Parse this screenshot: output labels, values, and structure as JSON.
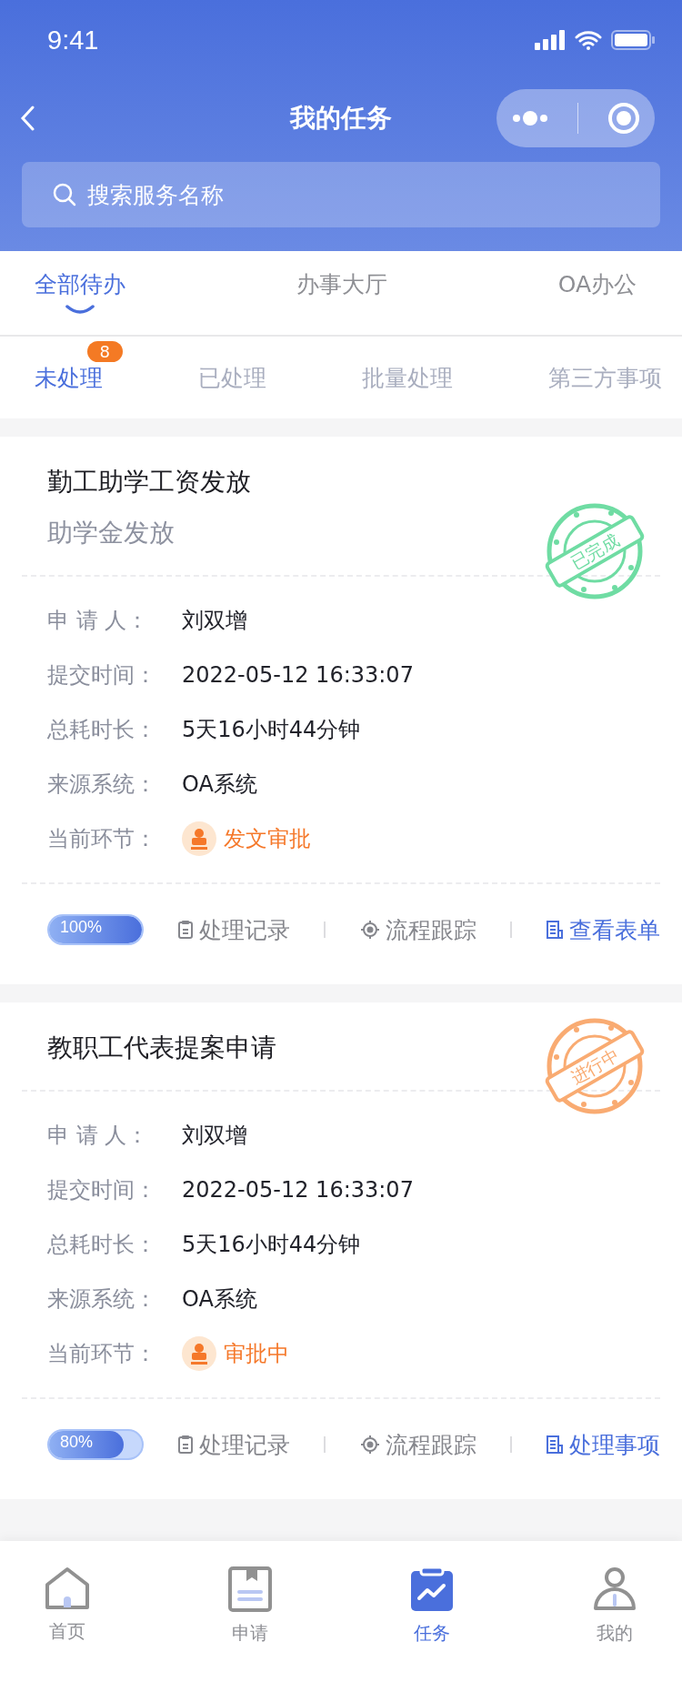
{
  "status_bar": {
    "time": "9:41"
  },
  "nav": {
    "title": "我的任务"
  },
  "search": {
    "placeholder": "搜索服务名称"
  },
  "tabs": [
    {
      "label": "全部待办",
      "selected": true
    },
    {
      "label": "办事大厅",
      "selected": false
    },
    {
      "label": "OA办公",
      "selected": false
    }
  ],
  "subtabs": [
    {
      "label": "未处理",
      "selected": true,
      "badge": "8"
    },
    {
      "label": "已处理",
      "selected": false
    },
    {
      "label": "批量处理",
      "selected": false
    },
    {
      "label": "第三方事项",
      "selected": false
    }
  ],
  "tasks": [
    {
      "title": "勤工助学工资发放",
      "subtitle": "助学金发放",
      "stamp": {
        "label": "已完成",
        "kind": "done"
      },
      "fields": [
        {
          "label": "申 请 人：",
          "value": "刘双增"
        },
        {
          "label": "提交时间：",
          "value": "2022-05-12 16:33:07"
        },
        {
          "label": "总耗时长：",
          "value": "5天16小时44分钟"
        },
        {
          "label": "来源系统：",
          "value": "OA系统"
        }
      ],
      "current_step": {
        "label": "当前环节：",
        "value": "发文审批"
      },
      "progress": {
        "level": 1,
        "reading": "100%"
      },
      "actions": [
        {
          "label": "处理记录",
          "kind": "record"
        },
        {
          "label": "流程跟踪",
          "kind": "trace"
        },
        {
          "label": "查看表单",
          "kind": "form"
        }
      ]
    },
    {
      "title": "教职工代表提案申请",
      "stamp": {
        "label": "进行中",
        "kind": "in_progress"
      },
      "fields": [
        {
          "label": "申 请 人：",
          "value": "刘双增"
        },
        {
          "label": "提交时间：",
          "value": "2022-05-12 16:33:07"
        },
        {
          "label": "总耗时长：",
          "value": "5天16小时44分钟"
        },
        {
          "label": "来源系统：",
          "value": "OA系统"
        }
      ],
      "current_step": {
        "label": "当前环节：",
        "value": "审批中"
      },
      "progress": {
        "level": 0.8,
        "reading": "80%"
      },
      "actions": [
        {
          "label": "处理记录",
          "kind": "record"
        },
        {
          "label": "流程跟踪",
          "kind": "trace"
        },
        {
          "label": "处理事项",
          "kind": "form"
        }
      ]
    }
  ],
  "bottom_nav": [
    {
      "label": "首页",
      "kind": "home",
      "selected": false
    },
    {
      "label": "申请",
      "kind": "apply",
      "selected": false
    },
    {
      "label": "任务",
      "kind": "task",
      "selected": true
    },
    {
      "label": "我的",
      "kind": "me",
      "selected": false
    }
  ]
}
